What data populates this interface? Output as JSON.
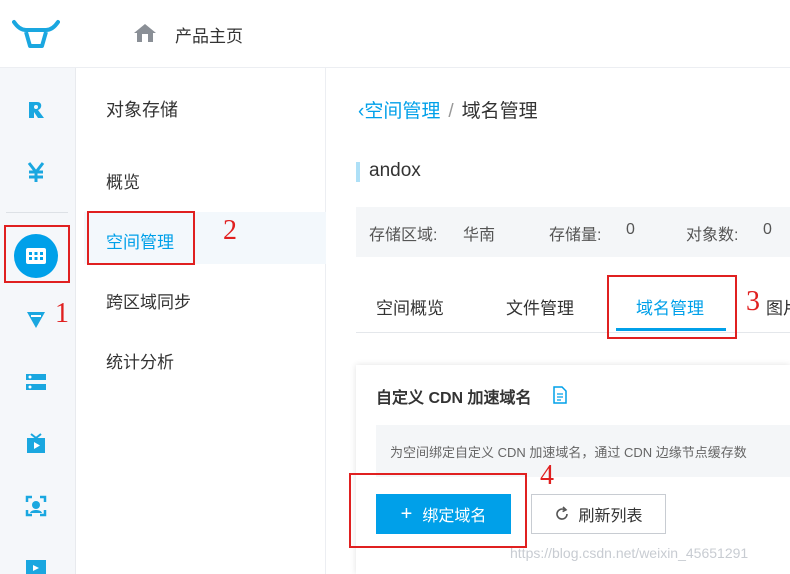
{
  "header": {
    "home_label": "产品主页"
  },
  "rail": {
    "icons": [
      "r-logo-icon",
      "yen-icon",
      "storage-icon",
      "funnel-icon",
      "server-icon",
      "tv-icon",
      "face-scan-icon",
      "film-icon"
    ]
  },
  "subnav": {
    "title": "对象存储",
    "items": [
      {
        "label": "概览"
      },
      {
        "label": "空间管理"
      },
      {
        "label": "跨区域同步"
      },
      {
        "label": "统计分析"
      }
    ]
  },
  "breadcrumb": {
    "back": "空间管理",
    "separator": "/",
    "current": "域名管理"
  },
  "bucket": {
    "name": "andox"
  },
  "info": {
    "region_label": "存储区域:",
    "region_value": "华南",
    "storage_label": "存储量:",
    "storage_value": "0",
    "objects_label": "对象数:",
    "objects_value": "0"
  },
  "tabs": [
    {
      "label": "空间概览"
    },
    {
      "label": "文件管理"
    },
    {
      "label": "域名管理"
    },
    {
      "label": "图片"
    }
  ],
  "card": {
    "title": "自定义 CDN 加速域名",
    "tip": "为空间绑定自定义 CDN 加速域名，通过 CDN 边缘节点缓存数",
    "bind_button": "绑定域名",
    "refresh_button": "刷新列表"
  },
  "annotations": [
    "1",
    "2",
    "3",
    "4"
  ],
  "watermark": "https://blog.csdn.net/weixin_45651291",
  "colors": {
    "accent": "#00a0e9",
    "annotation": "#e02020"
  }
}
